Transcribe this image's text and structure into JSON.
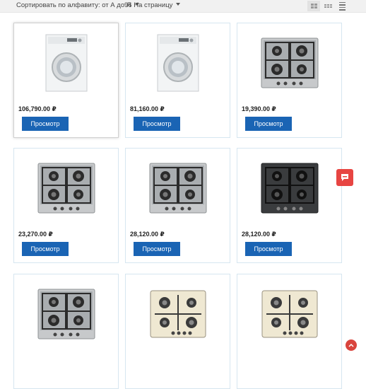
{
  "toolbar": {
    "sort_label": "Сортировать по алфавиту: от А до Я",
    "per_page_label": "96 На страницу",
    "view_modes": [
      "grid-large-icon",
      "grid-small-icon",
      "list-icon"
    ]
  },
  "products": [
    {
      "price": "106,790.00 ₽",
      "button": "Просмотр",
      "image": "washing-machine"
    },
    {
      "price": "81,160.00 ₽",
      "button": "Просмотр",
      "image": "washing-machine"
    },
    {
      "price": "19,390.00 ₽",
      "button": "Просмотр",
      "image": "gas-hob"
    },
    {
      "price": "23,270.00 ₽",
      "button": "Просмотр",
      "image": "gas-hob"
    },
    {
      "price": "28,120.00 ₽",
      "button": "Просмотр",
      "image": "gas-hob"
    },
    {
      "price": "28,120.00 ₽",
      "button": "Просмотр",
      "image": "gas-hob-black"
    },
    {
      "price": "",
      "button": "",
      "image": "gas-hob"
    },
    {
      "price": "",
      "button": "",
      "image": "gas-hob-beige"
    },
    {
      "price": "",
      "button": "",
      "image": "gas-hob-beige"
    }
  ],
  "colors": {
    "button_blue": "#1a64b4",
    "chat_red": "#e74542",
    "card_border": "#d6e6f0"
  },
  "widgets": {
    "chat_icon": "chat-bubble-icon",
    "scroll_icon": "arrow-up-icon"
  }
}
